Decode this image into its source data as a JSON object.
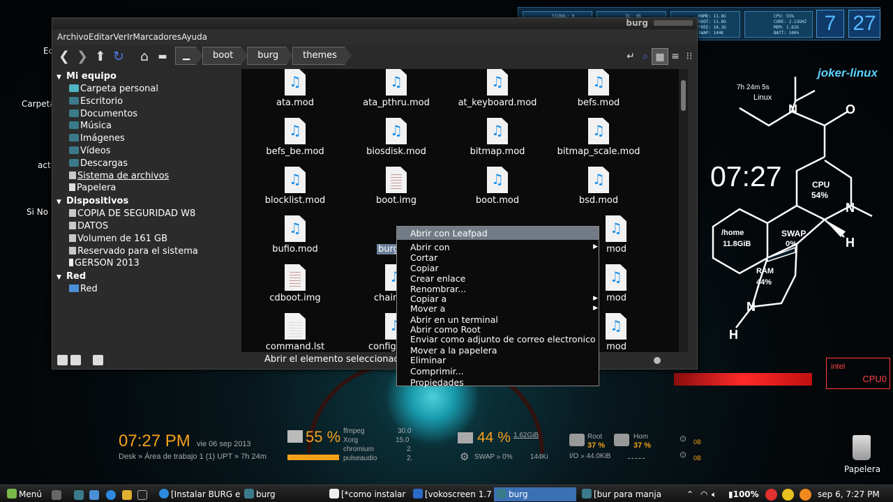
{
  "window": {
    "title": "burg",
    "menu": [
      "Archivo",
      "Editar",
      "Ver",
      "Ir",
      "Marcadores",
      "Ayuda"
    ],
    "breadcrumb": [
      "boot",
      "burg",
      "themes"
    ],
    "status_text": "Abrir el elemento seleccionado"
  },
  "sidebar": {
    "sections": [
      {
        "title": "Mi equipo",
        "items": [
          "Carpeta personal",
          "Escritorio",
          "Documentos",
          "Música",
          "Imágenes",
          "Vídeos",
          "Descargas",
          "Sistema de archivos",
          "Papelera"
        ]
      },
      {
        "title": "Dispositivos",
        "items": [
          "COPIA DE SEGURIDAD W8",
          "DATOS",
          "Volumen de 161 GB",
          "Reservado para el sistema",
          "GERSON 2013"
        ]
      },
      {
        "title": "Red",
        "items": [
          "Red"
        ]
      }
    ]
  },
  "files": [
    [
      "ata.mod",
      "ata_pthru.mod",
      "at_keyboard.mod",
      "befs.mod"
    ],
    [
      "befs_be.mod",
      "biosdisk.mod",
      "bitmap.mod",
      "bitmap_scale.mod"
    ],
    [
      "blocklist.mod",
      "boot.img",
      "boot.mod",
      "bsd.mod"
    ],
    [
      "bufio.mod",
      "burg",
      "",
      "mod"
    ],
    [
      "cdboot.img",
      "chain",
      "",
      "mod"
    ],
    [
      "command.lst",
      "configfi",
      "",
      "mod"
    ]
  ],
  "context_menu": {
    "items": [
      "Abrir con Leafpad",
      "Abrir con",
      "Cortar",
      "Copiar",
      "Crear enlace",
      "Renombrar...",
      "Copiar a",
      "Mover a",
      "Abrir en un terminal",
      "Abrir como Root",
      "Enviar como adjunto de correo electronico",
      "Mover a la papelera",
      "Eliminar",
      "Comprimir...",
      "Propiedades"
    ]
  },
  "desktop": {
    "left_labels": [
      "Ec",
      "Carpeta",
      "act",
      "Si No"
    ],
    "trash_label": "Papelera"
  },
  "monitor_strip": {
    "signal": "SIGNAL: 0",
    "dl": "DL: 0B",
    "home": "HOME: 11.8G",
    "root": "ROOT: 11.8G",
    "free": "FREE: 18.3G",
    "swap": "SWAP: 144K",
    "cpu": "CPU: 55%",
    "core": "CORE: 2.13GHZ",
    "mem": "MEM: 1.62G",
    "batt": "BATT: 100%",
    "hour": "7",
    "minute": "27"
  },
  "molecule": {
    "brand": "joker-linux",
    "uptime": "7h 24m 5s",
    "os": "Linux",
    "clock": "07:27",
    "cpu_label": "CPU",
    "cpu_value": "54%",
    "home_label": "/home",
    "home_value": "11.8GiB",
    "swap_label": "SWAP",
    "swap_value": "0%",
    "ram_label": "RAM",
    "ram_value": "44%",
    "atoms": [
      "N",
      "O",
      "N",
      "H",
      "N",
      "H"
    ]
  },
  "red_widget": {
    "brand": "intel",
    "label": "CPU0"
  },
  "conky": {
    "time": "07:27 PM",
    "date": "vie 06 sep 2013",
    "desk_line": "Desk » Área de trabajo 1 (1) UPT » 7h 24m",
    "cpu_pct": "55 %",
    "procs": [
      {
        "name": "ffmpeg",
        "val": "30.0"
      },
      {
        "name": "Xorg",
        "val": "15.0"
      },
      {
        "name": "chromium",
        "val": "2."
      },
      {
        "name": "pulseaudio",
        "val": "2."
      }
    ],
    "ram_pct": "44 %",
    "ram_used": "1.62GiB",
    "swap": "SWAP » 0%",
    "swap_size": "144Ki",
    "root_label": "Root",
    "root_pct": "37 %",
    "home_label": "Hom",
    "home_pct": "37 %",
    "io": "I/O » 44.0KiB",
    "net_up": "0B",
    "net_down": "0B"
  },
  "taskbar": {
    "menu_label": "Menú",
    "tasks": [
      "[Instalar BURG e...",
      "burg",
      "[*como instalar ...",
      "[vokoscreen 1.7....",
      "burg",
      "[bur para manja..."
    ],
    "battery": "100%",
    "clock": "sep 6, 7:27 PM"
  }
}
